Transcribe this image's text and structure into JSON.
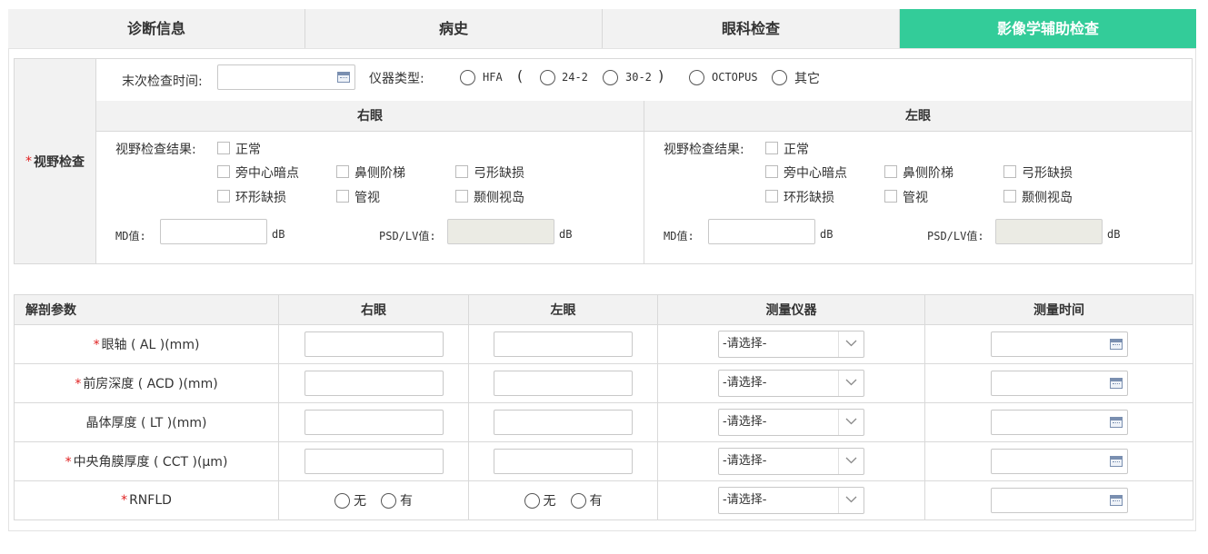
{
  "tabs": [
    {
      "label": "诊断信息",
      "active": false
    },
    {
      "label": "病史",
      "active": false
    },
    {
      "label": "眼科检查",
      "active": false
    },
    {
      "label": "影像学辅助检查",
      "active": true
    }
  ],
  "colors": {
    "active_tab": "#33cc99",
    "required": "#e02020",
    "header_bg": "#f2f2f2"
  },
  "visual_field": {
    "section_label": "视野检查",
    "required_mark": "*",
    "last_exam_label": "末次检查时间:",
    "instrument_label": "仪器类型:",
    "instruments": {
      "hfa": "HFA",
      "open_paren": "(",
      "opt1": "24-2",
      "opt2": "30-2",
      "close_paren": ")",
      "octopus": "OCTOPUS",
      "other": "其它"
    },
    "right_eye": "右眼",
    "left_eye": "左眼",
    "result_label": "视野检查结果:",
    "results": [
      "正常",
      "旁中心暗点",
      "鼻侧阶梯",
      "弓形缺损",
      "环形缺损",
      "管视",
      "颞侧视岛"
    ],
    "md_label": "MD值:",
    "psd_label": "PSD/LV值:",
    "unit": "dB"
  },
  "anatomy": {
    "headers": [
      "解剖参数",
      "右眼",
      "左眼",
      "测量仪器",
      "测量时间"
    ],
    "select_placeholder": "-请选择-",
    "rows": [
      {
        "required": true,
        "label": "眼轴 ( AL )(mm)",
        "type": "input"
      },
      {
        "required": true,
        "label": "前房深度 ( ACD )(mm)",
        "type": "input"
      },
      {
        "required": false,
        "label": "晶体厚度 ( LT )(mm)",
        "type": "input"
      },
      {
        "required": true,
        "label": "中央角膜厚度 ( CCT )(μm)",
        "type": "input"
      },
      {
        "required": true,
        "label": "RNFLD",
        "type": "radio"
      }
    ],
    "radio_options": [
      "无",
      "有"
    ]
  }
}
